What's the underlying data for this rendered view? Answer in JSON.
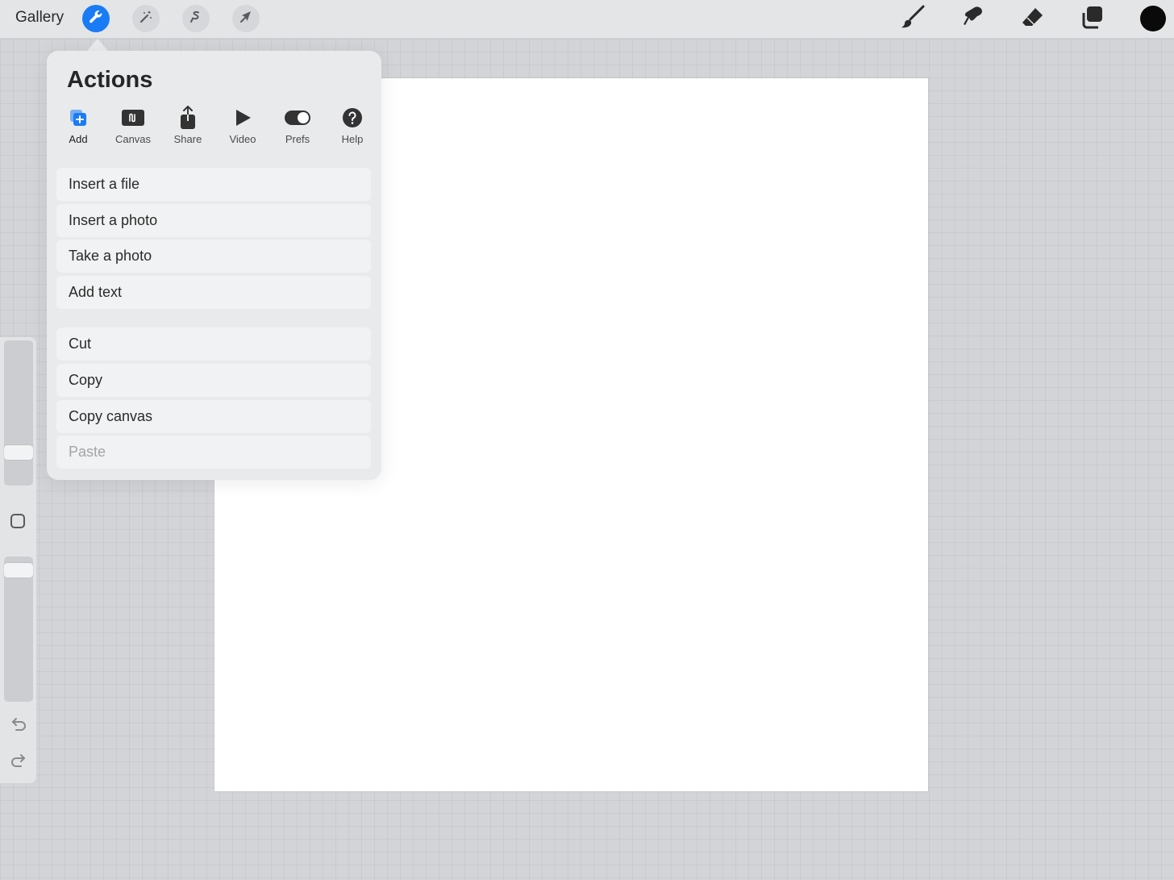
{
  "topbar": {
    "gallery_label": "Gallery",
    "left_tools": [
      "wrench-icon",
      "magic-wand-icon",
      "selection-icon",
      "transform-arrow-icon"
    ],
    "right_tools": [
      "brush-icon",
      "smudge-icon",
      "eraser-icon",
      "layers-icon"
    ],
    "current_color": "#0a0a0a",
    "accent": "#1a7cf5"
  },
  "actions": {
    "title": "Actions",
    "tabs": [
      {
        "label": "Add",
        "icon": "add-icon"
      },
      {
        "label": "Canvas",
        "icon": "canvas-icon"
      },
      {
        "label": "Share",
        "icon": "share-icon"
      },
      {
        "label": "Video",
        "icon": "video-play-icon"
      },
      {
        "label": "Prefs",
        "icon": "toggle-icon"
      },
      {
        "label": "Help",
        "icon": "help-icon"
      }
    ],
    "active_tab": "Add",
    "group1": [
      "Insert a file",
      "Insert a photo",
      "Take a photo",
      "Add text"
    ],
    "group2": [
      "Cut",
      "Copy",
      "Copy canvas",
      "Paste"
    ],
    "disabled_items": [
      "Paste"
    ]
  },
  "sidebar": {
    "brush_size_level": 0.2,
    "opacity_level": 0.95,
    "icons": [
      "modify-square-icon",
      "undo-icon",
      "redo-icon"
    ]
  }
}
